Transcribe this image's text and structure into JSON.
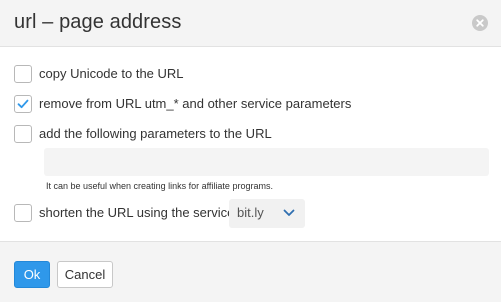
{
  "dialog": {
    "title": "url – page address"
  },
  "options": [
    {
      "label": "copy Unicode to the URL",
      "checked": false
    },
    {
      "label": "remove from URL utm_* and other service parameters",
      "checked": true
    },
    {
      "label": "add the following parameters to the URL",
      "checked": false
    },
    {
      "label": "shorten the URL using the service",
      "checked": false
    }
  ],
  "params": {
    "value": "",
    "placeholder": "",
    "hint": "It can be useful when creating links for affiliate programs."
  },
  "service": {
    "selected": "bit.ly"
  },
  "buttons": {
    "ok": "Ok",
    "cancel": "Cancel"
  },
  "colors": {
    "accent": "#2f98ea",
    "check": "#2f98ea"
  }
}
